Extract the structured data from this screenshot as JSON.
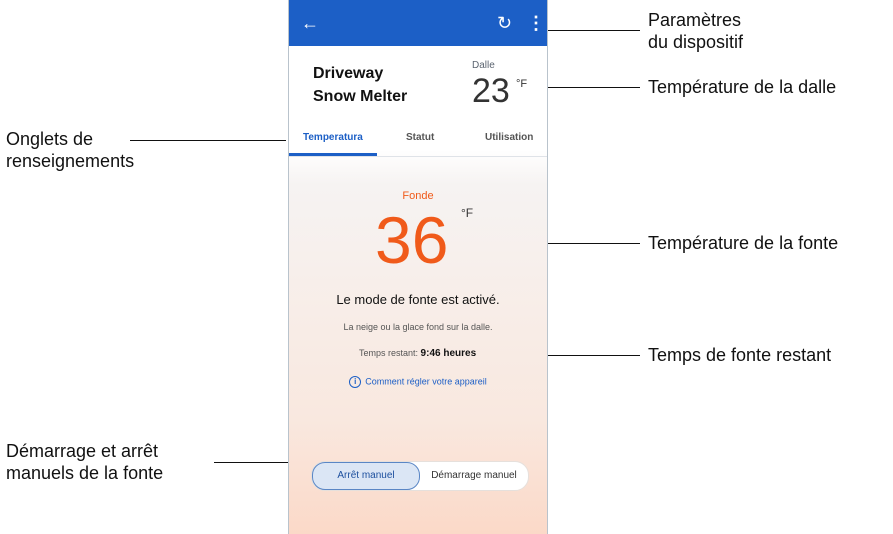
{
  "callouts": {
    "device_settings": [
      "Paramètres",
      "du dispositif"
    ],
    "slab_temp": "Température de la dalle",
    "info_tabs": [
      "Onglets de",
      "renseignements"
    ],
    "melt_temp": "Température de la fonte",
    "remaining_time": "Temps de fonte restant",
    "manual_control": [
      "Démarrage et arrêt",
      "manuels de la fonte"
    ]
  },
  "app": {
    "header_icons": [
      "back-arrow-icon",
      "refresh-icon",
      "more-vertical-icon"
    ],
    "header_color": "#1c5fc6",
    "device_name": [
      "Driveway",
      "Snow Melter"
    ],
    "slab": {
      "label": "Dalle",
      "value": "23",
      "unit": "°F"
    },
    "tabs": [
      {
        "label": "Temperatura",
        "active": true
      },
      {
        "label": "Statut",
        "active": false
      },
      {
        "label": "Utilisation",
        "active": false
      }
    ],
    "melt": {
      "label": "Fonde",
      "value": "36",
      "unit": "°F",
      "color": "#f05a1a"
    },
    "status": "Le mode de fonte est activé.",
    "sub_status": "La neige ou la glace fond sur la dalle.",
    "remaining": {
      "label": "Temps restant:",
      "value": "9:46 heures"
    },
    "help_link": "Comment régler votre appareil",
    "buttons": {
      "stop": "Arrêt manuel",
      "start": "Démarrage manuel"
    }
  }
}
